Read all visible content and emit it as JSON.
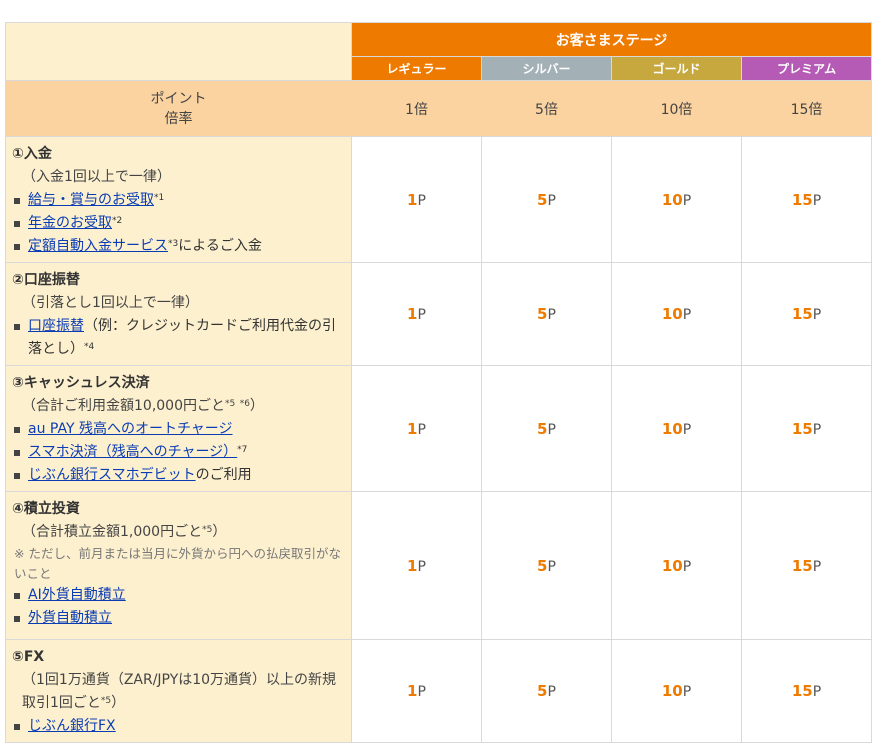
{
  "header": {
    "stage_title": "お客さまステージ",
    "point_label_line1": "ポイント",
    "point_label_line2": "倍率"
  },
  "tiers": [
    {
      "label": "レギュラー",
      "rate": "1倍",
      "color": "#ee7a00"
    },
    {
      "label": "シルバー",
      "rate": "5倍",
      "color": "#a3b0b5"
    },
    {
      "label": "ゴールド",
      "rate": "10倍",
      "color": "#c6a83f"
    },
    {
      "label": "プレミアム",
      "rate": "15倍",
      "color": "#b55bb6"
    }
  ],
  "point_unit": "P",
  "rows": [
    {
      "title": "①入金",
      "sub": "（入金1回以上で一律）",
      "items": [
        {
          "link": "給与・賞与のお受取",
          "sup": "*1",
          "after": ""
        },
        {
          "link": "年金のお受取",
          "sup": "*2",
          "after": ""
        },
        {
          "link": "定額自動入金サービス",
          "sup": "*3",
          "after": "によるご入金"
        }
      ],
      "points": [
        "1",
        "5",
        "10",
        "15"
      ]
    },
    {
      "title": "②口座振替",
      "sub": "（引落とし1回以上で一律）",
      "items": [
        {
          "link": "口座振替",
          "after": "（例：クレジットカードご利用代金の引落とし）",
          "sup": "*4"
        }
      ],
      "points": [
        "1",
        "5",
        "10",
        "15"
      ]
    },
    {
      "title": "③キャッシュレス決済",
      "sub_before": "（合計ご利用金額10,000円ごと",
      "sub_sup1": "*5",
      "sub_sup2": "*6",
      "sub_after": "）",
      "items": [
        {
          "link": "au PAY 残高へのオートチャージ",
          "sup": "",
          "after": ""
        },
        {
          "link": "スマホ決済（残高へのチャージ）",
          "sup": "*7",
          "after": ""
        },
        {
          "link": "じぶん銀行スマホデビット",
          "sup": "",
          "after": "のご利用"
        }
      ],
      "points": [
        "1",
        "5",
        "10",
        "15"
      ]
    },
    {
      "title": "④積立投資",
      "sub_before": "（合計積立金額1,000円ごと",
      "sub_sup1": "*5",
      "sub_after": "）",
      "note": "※ ただし、前月または当月に外貨から円への払戻取引がないこと",
      "items": [
        {
          "link": "AI外貨自動積立"
        },
        {
          "link": "外貨自動積立"
        }
      ],
      "points": [
        "1",
        "5",
        "10",
        "15"
      ]
    },
    {
      "title": "⑤FX",
      "sub_before": "（1回1万通貨（ZAR/JPYは10万通貨）以上の新規取引1回ごと",
      "sub_sup1": "*5",
      "sub_after": "）",
      "items": [
        {
          "link": "じぶん銀行FX"
        }
      ],
      "points": [
        "1",
        "5",
        "10",
        "15"
      ]
    }
  ]
}
